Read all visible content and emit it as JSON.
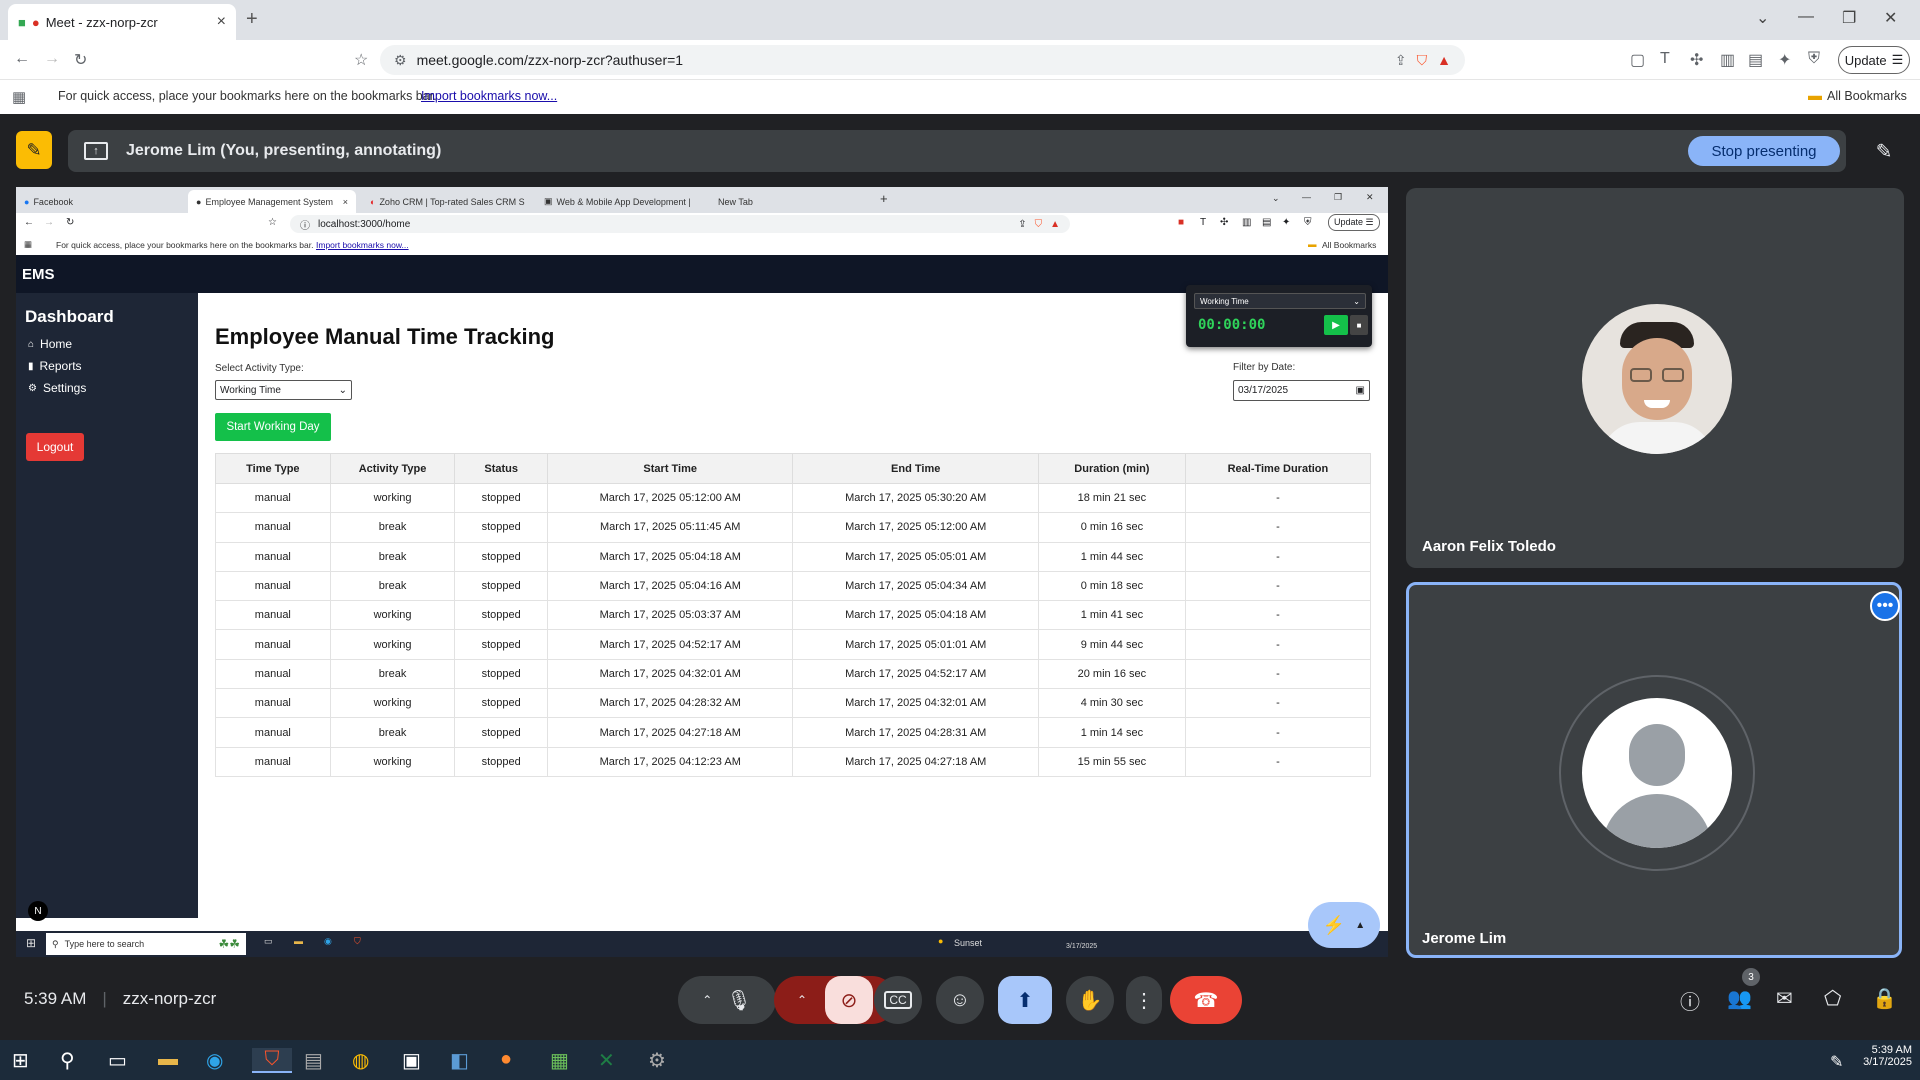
{
  "browser": {
    "tab_title": "Meet - zzx-norp-zcr",
    "url": "meet.google.com/zzx-norp-zcr?authuser=1",
    "update_label": "Update",
    "bookmarks_prompt": "For quick access, place your bookmarks here on the bookmarks bar.",
    "import_link": "Import bookmarks now...",
    "all_bookmarks": "All Bookmarks"
  },
  "meet": {
    "presenting_text": "Jerome Lim (You, presenting, annotating)",
    "stop_presenting": "Stop presenting",
    "time": "5:39 AM",
    "meeting_code": "zzx-norp-zcr",
    "participants_count": "3",
    "participants": [
      {
        "name": "Aaron Felix Toledo"
      },
      {
        "name": "Jerome Lim"
      }
    ]
  },
  "shared": {
    "tabs": [
      {
        "label": "Facebook"
      },
      {
        "label": "Employee Management System"
      },
      {
        "label": "Zoho CRM | Top-rated Sales CRM S"
      },
      {
        "label": "Web & Mobile App Development |"
      },
      {
        "label": "New Tab"
      }
    ],
    "url": "localhost:3000/home",
    "update_label": "Update",
    "bookmarks_prompt": "For quick access, place your bookmarks here on the bookmarks bar.",
    "import_link": "Import bookmarks now...",
    "all_bookmarks": "All Bookmarks",
    "app": {
      "brand": "EMS",
      "sidebar_title": "Dashboard",
      "nav": [
        {
          "label": "Home",
          "icon": "home-icon"
        },
        {
          "label": "Reports",
          "icon": "chart-icon"
        },
        {
          "label": "Settings",
          "icon": "gear-icon"
        }
      ],
      "logout": "Logout",
      "page_title": "Employee Manual Time Tracking",
      "activity_label": "Select Activity Type:",
      "activity_value": "Working Time",
      "filter_label": "Filter by Date:",
      "filter_value": "03/17/2025",
      "start_button": "Start Working Day",
      "timer": {
        "mode": "Working Time",
        "display": "00:00:00"
      },
      "table": {
        "headers": [
          "Time Type",
          "Activity Type",
          "Status",
          "Start Time",
          "End Time",
          "Duration (min)",
          "Real-Time Duration"
        ],
        "rows": [
          [
            "manual",
            "working",
            "stopped",
            "March 17, 2025 05:12:00 AM",
            "March 17, 2025 05:30:20 AM",
            "18 min 21 sec",
            "-"
          ],
          [
            "manual",
            "break",
            "stopped",
            "March 17, 2025 05:11:45 AM",
            "March 17, 2025 05:12:00 AM",
            "0 min 16 sec",
            "-"
          ],
          [
            "manual",
            "break",
            "stopped",
            "March 17, 2025 05:04:18 AM",
            "March 17, 2025 05:05:01 AM",
            "1 min 44 sec",
            "-"
          ],
          [
            "manual",
            "break",
            "stopped",
            "March 17, 2025 05:04:16 AM",
            "March 17, 2025 05:04:34 AM",
            "0 min 18 sec",
            "-"
          ],
          [
            "manual",
            "working",
            "stopped",
            "March 17, 2025 05:03:37 AM",
            "March 17, 2025 05:04:18 AM",
            "1 min 41 sec",
            "-"
          ],
          [
            "manual",
            "working",
            "stopped",
            "March 17, 2025 04:52:17 AM",
            "March 17, 2025 05:01:01 AM",
            "9 min 44 sec",
            "-"
          ],
          [
            "manual",
            "break",
            "stopped",
            "March 17, 2025 04:32:01 AM",
            "March 17, 2025 04:52:17 AM",
            "20 min 16 sec",
            "-"
          ],
          [
            "manual",
            "working",
            "stopped",
            "March 17, 2025 04:28:32 AM",
            "March 17, 2025 04:32:01 AM",
            "4 min 30 sec",
            "-"
          ],
          [
            "manual",
            "break",
            "stopped",
            "March 17, 2025 04:27:18 AM",
            "March 17, 2025 04:28:31 AM",
            "1 min 14 sec",
            "-"
          ],
          [
            "manual",
            "working",
            "stopped",
            "March 17, 2025 04:12:23 AM",
            "March 17, 2025 04:27:18 AM",
            "15 min 55 sec",
            "-"
          ]
        ]
      }
    },
    "taskbar": {
      "search_placeholder": "Type here to search",
      "weather": "Sunset",
      "date": "3/17/2025"
    }
  },
  "os_taskbar": {
    "time": "5:39 AM",
    "date": "3/17/2025"
  },
  "colors": {
    "meet_bg": "#202124",
    "accent_blue": "#8ab4f8",
    "end_call_red": "#ea4335",
    "start_green": "#14c04a",
    "logout_red": "#e53935"
  }
}
